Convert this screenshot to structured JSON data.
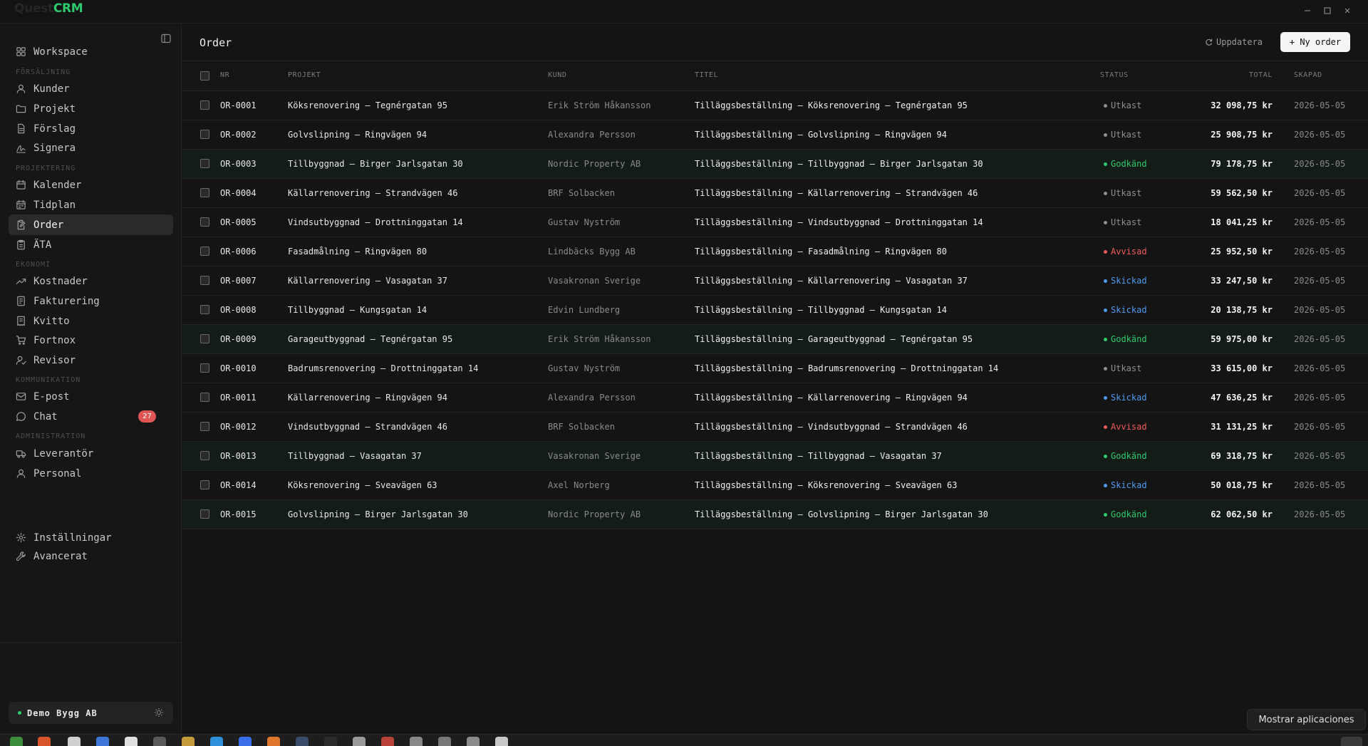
{
  "app": {
    "logo_dim": "Quest",
    "logo_accent": "CRM"
  },
  "sidebar": {
    "top_item": {
      "label": "Workspace",
      "icon": "grid-icon"
    },
    "sections": [
      {
        "label": "FÖRSÄLJNING",
        "items": [
          {
            "label": "Kunder",
            "icon": "user-icon"
          },
          {
            "label": "Projekt",
            "icon": "folder-icon"
          },
          {
            "label": "Förslag",
            "icon": "document-icon"
          },
          {
            "label": "Signera",
            "icon": "signature-icon"
          }
        ]
      },
      {
        "label": "PROJEKTERING",
        "items": [
          {
            "label": "Kalender",
            "icon": "calendar-icon"
          },
          {
            "label": "Tidplan",
            "icon": "calendar-range-icon"
          },
          {
            "label": "Order",
            "icon": "clipboard-edit-icon",
            "active": true
          },
          {
            "label": "ÄTA",
            "icon": "clipboard-icon"
          }
        ]
      },
      {
        "label": "EKONOMI",
        "items": [
          {
            "label": "Kostnader",
            "icon": "trending-icon"
          },
          {
            "label": "Fakturering",
            "icon": "invoice-icon"
          },
          {
            "label": "Kvitto",
            "icon": "receipt-icon"
          },
          {
            "label": "Fortnox",
            "icon": "cart-icon"
          },
          {
            "label": "Revisor",
            "icon": "user-check-icon"
          }
        ]
      },
      {
        "label": "KOMMUNIKATION",
        "items": [
          {
            "label": "E-post",
            "icon": "mail-icon"
          },
          {
            "label": "Chat",
            "icon": "chat-icon",
            "badge": "27"
          }
        ]
      },
      {
        "label": "ADMINISTRATION",
        "items": [
          {
            "label": "Leverantör",
            "icon": "truck-icon"
          },
          {
            "label": "Personal",
            "icon": "user-icon"
          }
        ]
      }
    ],
    "bottom": [
      {
        "label": "Inställningar",
        "icon": "gear-icon"
      },
      {
        "label": "Avancerat",
        "icon": "wrench-icon"
      }
    ],
    "org": {
      "name": "Demo Bygg AB",
      "status_color": "#2fca6e"
    }
  },
  "header": {
    "title": "Order",
    "refresh_label": "Uppdatera",
    "new_label": "+ Ny order"
  },
  "table": {
    "columns": {
      "nr": "NR",
      "projekt": "PROJEKT",
      "kund": "KUND",
      "titel": "TITEL",
      "status": "STATUS",
      "total": "TOTAL",
      "skapad": "SKAPAD"
    },
    "rows": [
      {
        "nr": "OR-0001",
        "projekt": "Köksrenovering — Tegnérgatan 95",
        "kund": "Erik Ström Håkansson",
        "titel": "Tilläggsbeställning — Köksrenovering — Tegnérgatan 95",
        "status": "Utkast",
        "total": "32 098,75 kr",
        "skapad": "2026-05-05"
      },
      {
        "nr": "OR-0002",
        "projekt": "Golvslipning — Ringvägen 94",
        "kund": "Alexandra Persson",
        "titel": "Tilläggsbeställning — Golvslipning — Ringvägen 94",
        "status": "Utkast",
        "total": "25 908,75 kr",
        "skapad": "2026-05-05"
      },
      {
        "nr": "OR-0003",
        "projekt": "Tillbyggnad — Birger Jarlsgatan 30",
        "kund": "Nordic Property AB",
        "titel": "Tilläggsbeställning — Tillbyggnad — Birger Jarlsgatan 30",
        "status": "Godkänd",
        "total": "79 178,75 kr",
        "skapad": "2026-05-05"
      },
      {
        "nr": "OR-0004",
        "projekt": "Källarrenovering — Strandvägen 46",
        "kund": "BRF Solbacken",
        "titel": "Tilläggsbeställning — Källarrenovering — Strandvägen 46",
        "status": "Utkast",
        "total": "59 562,50 kr",
        "skapad": "2026-05-05"
      },
      {
        "nr": "OR-0005",
        "projekt": "Vindsutbyggnad — Drottninggatan 14",
        "kund": "Gustav Nyström",
        "titel": "Tilläggsbeställning — Vindsutbyggnad — Drottninggatan 14",
        "status": "Utkast",
        "total": "18 041,25 kr",
        "skapad": "2026-05-05"
      },
      {
        "nr": "OR-0006",
        "projekt": "Fasadmålning — Ringvägen 80",
        "kund": "Lindbäcks Bygg AB",
        "titel": "Tilläggsbeställning — Fasadmålning — Ringvägen 80",
        "status": "Avvisad",
        "total": "25 952,50 kr",
        "skapad": "2026-05-05"
      },
      {
        "nr": "OR-0007",
        "projekt": "Källarrenovering — Vasagatan 37",
        "kund": "Vasakronan Sverige",
        "titel": "Tilläggsbeställning — Källarrenovering — Vasagatan 37",
        "status": "Skickad",
        "total": "33 247,50 kr",
        "skapad": "2026-05-05"
      },
      {
        "nr": "OR-0008",
        "projekt": "Tillbyggnad — Kungsgatan 14",
        "kund": "Edvin Lundberg",
        "titel": "Tilläggsbeställning — Tillbyggnad — Kungsgatan 14",
        "status": "Skickad",
        "total": "20 138,75 kr",
        "skapad": "2026-05-05"
      },
      {
        "nr": "OR-0009",
        "projekt": "Garageutbyggnad — Tegnérgatan 95",
        "kund": "Erik Ström Håkansson",
        "titel": "Tilläggsbeställning — Garageutbyggnad — Tegnérgatan 95",
        "status": "Godkänd",
        "total": "59 975,00 kr",
        "skapad": "2026-05-05"
      },
      {
        "nr": "OR-0010",
        "projekt": "Badrumsrenovering — Drottninggatan 14",
        "kund": "Gustav Nyström",
        "titel": "Tilläggsbeställning — Badrumsrenovering — Drottninggatan 14",
        "status": "Utkast",
        "total": "33 615,00 kr",
        "skapad": "2026-05-05"
      },
      {
        "nr": "OR-0011",
        "projekt": "Källarrenovering — Ringvägen 94",
        "kund": "Alexandra Persson",
        "titel": "Tilläggsbeställning — Källarrenovering — Ringvägen 94",
        "status": "Skickad",
        "total": "47 636,25 kr",
        "skapad": "2026-05-05"
      },
      {
        "nr": "OR-0012",
        "projekt": "Vindsutbyggnad — Strandvägen 46",
        "kund": "BRF Solbacken",
        "titel": "Tilläggsbeställning — Vindsutbyggnad — Strandvägen 46",
        "status": "Avvisad",
        "total": "31 131,25 kr",
        "skapad": "2026-05-05"
      },
      {
        "nr": "OR-0013",
        "projekt": "Tillbyggnad — Vasagatan 37",
        "kund": "Vasakronan Sverige",
        "titel": "Tilläggsbeställning — Tillbyggnad — Vasagatan 37",
        "status": "Godkänd",
        "total": "69 318,75 kr",
        "skapad": "2026-05-05"
      },
      {
        "nr": "OR-0014",
        "projekt": "Köksrenovering — Sveavägen 63",
        "kund": "Axel Norberg",
        "titel": "Tilläggsbeställning — Köksrenovering — Sveavägen 63",
        "status": "Skickad",
        "total": "50 018,75 kr",
        "skapad": "2026-05-05"
      },
      {
        "nr": "OR-0015",
        "projekt": "Golvslipning — Birger Jarlsgatan 30",
        "kund": "Nordic Property AB",
        "titel": "Tilläggsbeställning — Golvslipning — Birger Jarlsgatan 30",
        "status": "Godkänd",
        "total": "62 062,50 kr",
        "skapad": "2026-05-05"
      }
    ]
  },
  "status_colors": {
    "Utkast": "#8f8f8f",
    "Godkänd": "#2fca6e",
    "Avvisad": "#ee5a5a",
    "Skickad": "#4f9bf0"
  },
  "taskbar": {
    "tooltip": "Mostrar aplicaciones"
  }
}
